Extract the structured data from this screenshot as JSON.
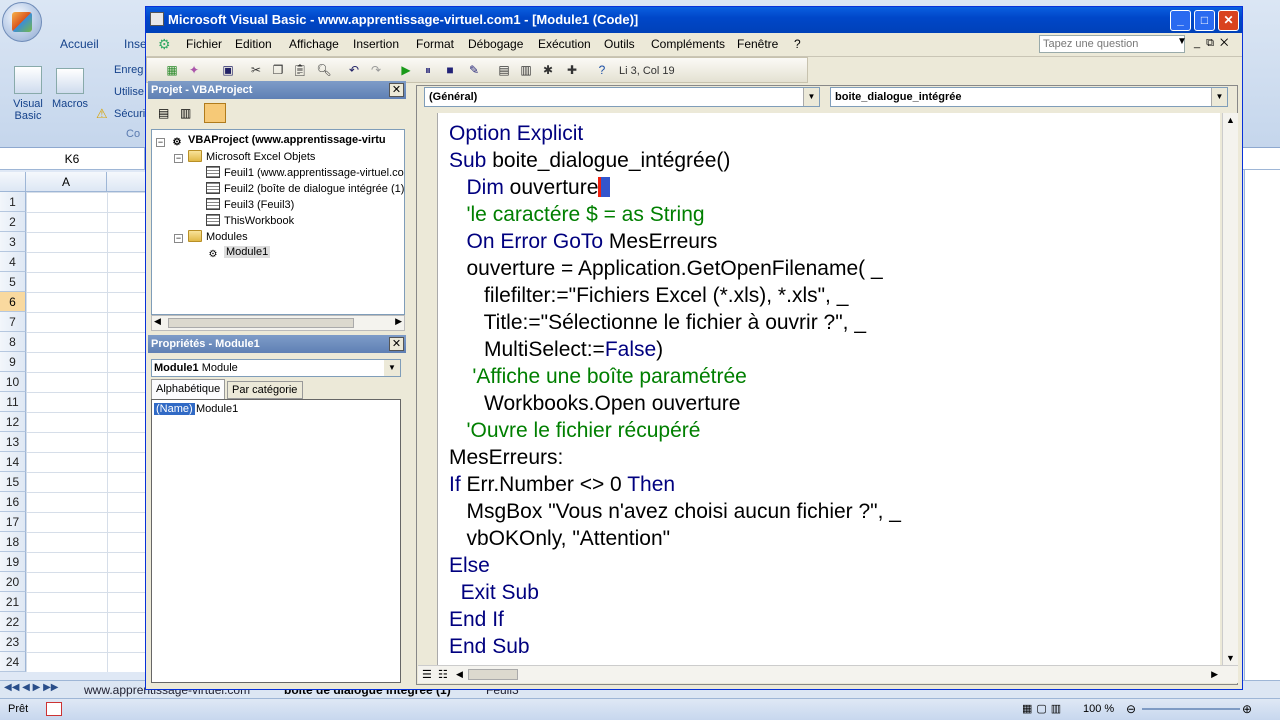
{
  "excel": {
    "ribbon_tabs": [
      "Accueil",
      "Inse"
    ],
    "ribbon_buttons": {
      "visual_basic": "Visual Basic",
      "macros": "Macros",
      "enreg": "Enreg",
      "utilise": "Utilise",
      "secur": "Sécuri",
      "code_group": "Co"
    },
    "name_box": "K6",
    "column_header": "A",
    "row_numbers": [
      "1",
      "2",
      "3",
      "4",
      "5",
      "6",
      "7",
      "8",
      "9",
      "10",
      "11",
      "12",
      "13",
      "14",
      "15",
      "16",
      "17",
      "18",
      "19",
      "20",
      "21",
      "22",
      "23",
      "24"
    ],
    "selected_row": "6",
    "sheet_tabs": [
      "www.apprentissage-virtuel.com",
      "boîte de dialogue intégrée (1)",
      "Feuil3"
    ],
    "status": "Prêt",
    "zoom": "100 %"
  },
  "vbe": {
    "title": "Microsoft Visual Basic - www.apprentissage-virtuel.com1 - [Module1 (Code)]",
    "menu": [
      "Fichier",
      "Edition",
      "Affichage",
      "Insertion",
      "Format",
      "Débogage",
      "Exécution",
      "Outils",
      "Compléments",
      "Fenêtre",
      "?"
    ],
    "help_placeholder": "Tapez une question",
    "cursor_position": "Li 3, Col 19",
    "project": {
      "title": "Projet - VBAProject",
      "root": "VBAProject (www.apprentissage-virtu",
      "excel_objects": "Microsoft Excel Objets",
      "sheets": [
        "Feuil1 (www.apprentissage-virtuel.co",
        "Feuil2 (boîte de dialogue intégrée (1)",
        "Feuil3 (Feuil3)",
        "ThisWorkbook"
      ],
      "modules_folder": "Modules",
      "module": "Module1"
    },
    "properties": {
      "title": "Propriétés - Module1",
      "object": "Module1",
      "object_type": "Module",
      "tabs": [
        "Alphabétique",
        "Par catégorie"
      ],
      "name_key": "(Name)",
      "name_value": "Module1"
    },
    "code": {
      "object_combo": "(Général)",
      "proc_combo": "boite_dialogue_intégrée"
    }
  }
}
